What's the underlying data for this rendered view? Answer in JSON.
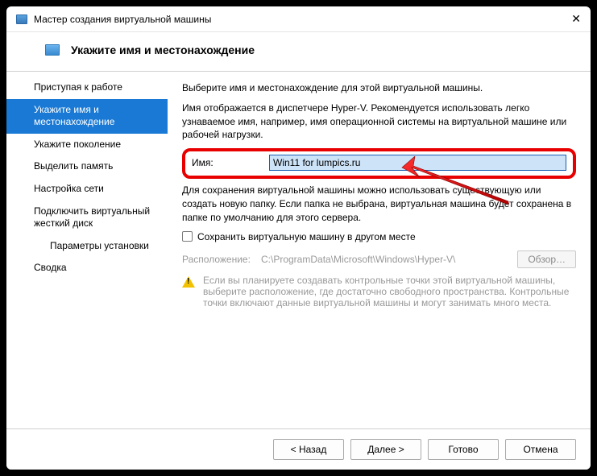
{
  "window": {
    "title": "Мастер создания виртуальной машины"
  },
  "header": {
    "title": "Укажите имя и местонахождение"
  },
  "sidebar": {
    "items": [
      {
        "label": "Приступая к работе"
      },
      {
        "label": "Укажите имя и местонахождение"
      },
      {
        "label": "Укажите поколение"
      },
      {
        "label": "Выделить память"
      },
      {
        "label": "Настройка сети"
      },
      {
        "label": "Подключить виртуальный жесткий диск"
      },
      {
        "label": "Параметры установки"
      },
      {
        "label": "Сводка"
      }
    ]
  },
  "content": {
    "intro": "Выберите имя и местонахождение для этой виртуальной машины.",
    "desc": "Имя отображается в диспетчере Hyper-V. Рекомендуется использовать легко узнаваемое имя, например, имя операционной системы на виртуальной машине или рабочей нагрузки.",
    "name_label": "Имя:",
    "name_value": "Win11 for lumpics.ru",
    "save_desc": "Для сохранения виртуальной машины можно использовать существующую или создать новую папку. Если папка не выбрана, виртуальная машина будет сохранена в папке по умолчанию для этого сервера.",
    "save_checkbox_label": "Сохранить виртуальную машину в другом месте",
    "location_label": "Расположение:",
    "location_value": "C:\\ProgramData\\Microsoft\\Windows\\Hyper-V\\",
    "browse_label": "Обзор…",
    "warning": "Если вы планируете создавать контрольные точки этой виртуальной машины, выберите расположение, где достаточно свободного пространства. Контрольные точки включают данные виртуальной машины и могут занимать много места."
  },
  "buttons": {
    "back": "< Назад",
    "next": "Далее >",
    "finish": "Готово",
    "cancel": "Отмена"
  }
}
